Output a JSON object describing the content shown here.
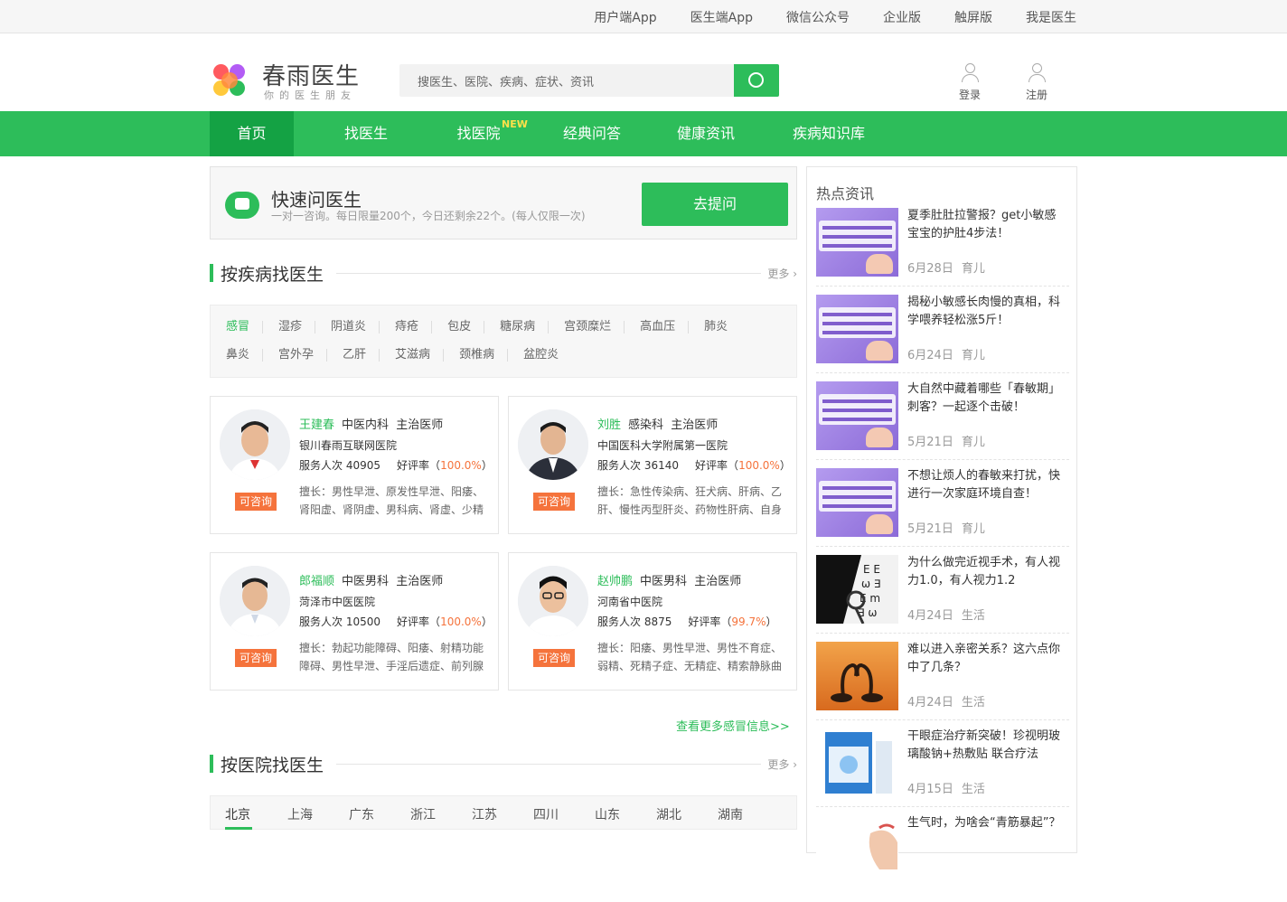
{
  "topbar": {
    "links": [
      "用户端App",
      "医生端App",
      "微信公众号",
      "企业版",
      "触屏版",
      "我是医生"
    ]
  },
  "brand": {
    "name": "春雨医生",
    "slogan": "你的医生朋友"
  },
  "search": {
    "placeholder": "搜医生、医院、疾病、症状、资讯"
  },
  "user": {
    "login": "登录",
    "register": "注册"
  },
  "nav": {
    "items": [
      "首页",
      "找医生",
      "找医院",
      "经典问答",
      "健康资讯",
      "疾病知识库"
    ],
    "new_badge": "NEW"
  },
  "quick": {
    "title": "快速问医生",
    "desc": "一对一咨询。每日限量200个，今日还剩余22个。(每人仅限一次)",
    "button": "去提问"
  },
  "disease_section": {
    "title": "按疾病找医生",
    "more": "更多"
  },
  "diseases": {
    "row1": [
      "感冒",
      "湿疹",
      "阴道炎",
      "痔疮",
      "包皮",
      "糖尿病",
      "宫颈糜烂",
      "高血压",
      "肺炎"
    ],
    "row2": [
      "鼻炎",
      "宫外孕",
      "乙肝",
      "艾滋病",
      "颈椎病",
      "盆腔炎"
    ]
  },
  "doctors": [
    {
      "name": "王建春",
      "dept": "中医内科",
      "title": "主治医师",
      "hospital": "银川春雨互联网医院",
      "service_label": "服务人次",
      "service": "40905",
      "rate_label": "好评率",
      "rate": "100.0%",
      "skill": "擅长：男性早泄、原发性早泄、阳痿、肾阳虚、肾阴虚、男科病、肾虚、少精症",
      "tag": "可咨询"
    },
    {
      "name": "刘胜",
      "dept": "感染科",
      "title": "主治医师",
      "hospital": "中国医科大学附属第一医院",
      "service_label": "服务人次",
      "service": "36140",
      "rate_label": "好评率",
      "rate": "100.0%",
      "skill": "擅长：急性传染病、狂犬病、肝病、乙肝、慢性丙型肝炎、药物性肝病、自身免疫性肝病",
      "tag": "可咨询"
    },
    {
      "name": "郎福顺",
      "dept": "中医男科",
      "title": "主治医师",
      "hospital": "菏泽市中医医院",
      "service_label": "服务人次",
      "service": "10500",
      "rate_label": "好评率",
      "rate": "100.0%",
      "skill": "擅长：勃起功能障碍、阳痿、射精功能障碍、男性早泄、手淫后遗症、前列腺炎",
      "tag": "可咨询"
    },
    {
      "name": "赵帅鹏",
      "dept": "中医男科",
      "title": "主治医师",
      "hospital": "河南省中医院",
      "service_label": "服务人次",
      "service": "8875",
      "rate_label": "好评率",
      "rate": "99.7%",
      "skill": "擅长：阳痿、男性早泄、男性不育症、弱精、死精子症、无精症、精索静脉曲张",
      "tag": "可咨询"
    }
  ],
  "more_flu": "查看更多感冒信息>>",
  "hospital_section": {
    "title": "按医院找医生",
    "more": "更多"
  },
  "cities": [
    "北京",
    "上海",
    "广东",
    "浙江",
    "江苏",
    "四川",
    "山东",
    "湖北",
    "湖南"
  ],
  "hot": {
    "title": "热点资讯",
    "items": [
      {
        "title": "夏季肚肚拉警报？get小敏感宝宝的护肚4步法！",
        "date": "6月28日",
        "cat": "育儿"
      },
      {
        "title": "揭秘小敏感长肉慢的真相，科学喂养轻松涨5斤！",
        "date": "6月24日",
        "cat": "育儿"
      },
      {
        "title": "大自然中藏着哪些「春敏期」刺客？一起逐个击破！",
        "date": "5月21日",
        "cat": "育儿"
      },
      {
        "title": "不想让烦人的春敏来打扰，快进行一次家庭环境自查！",
        "date": "5月21日",
        "cat": "育儿"
      },
      {
        "title": "为什么做完近视手术，有人视力1.0，有人视力1.2",
        "date": "4月24日",
        "cat": "生活"
      },
      {
        "title": "难以进入亲密关系？这六点你中了几条？",
        "date": "4月24日",
        "cat": "生活"
      },
      {
        "title": "干眼症治疗新突破！珍视明玻璃酸钠+热敷贴 联合疗法",
        "date": "4月15日",
        "cat": "生活"
      },
      {
        "title": "生气时，为啥会“青筋暴起”？",
        "date": "",
        "cat": ""
      }
    ]
  },
  "colors": {
    "brand_green": "#2dbd5a",
    "nav_active": "#14a244",
    "accent_orange": "#f5733c"
  }
}
